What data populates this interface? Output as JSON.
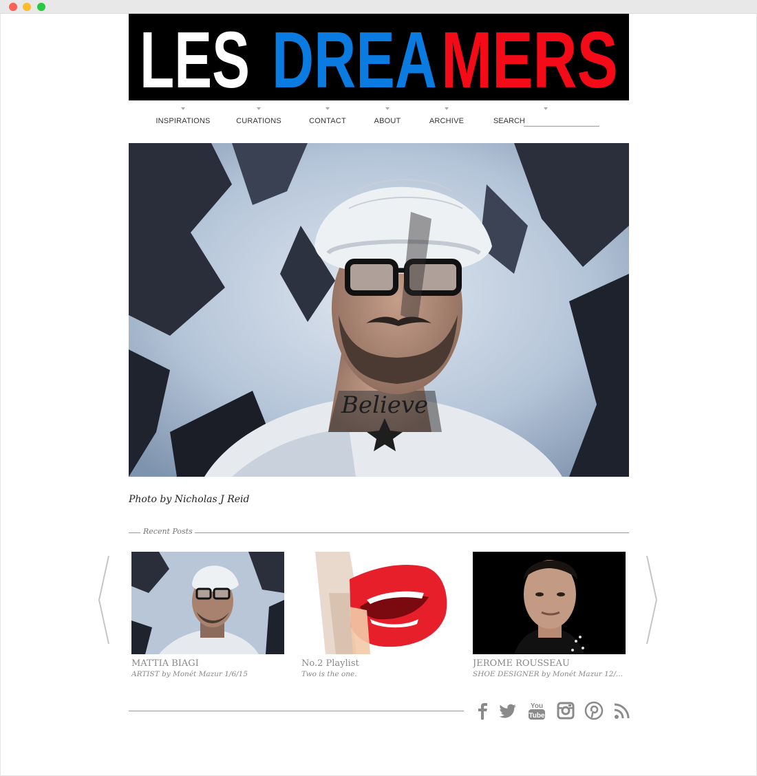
{
  "site": {
    "logo_words": [
      {
        "text": "LES",
        "color": "#ffffff"
      },
      {
        "text": "DREA",
        "color": "#0a7be0"
      },
      {
        "text": "MERS",
        "color": "#f50a17"
      }
    ]
  },
  "nav": {
    "items": [
      {
        "label": "INSPIRATIONS"
      },
      {
        "label": "CURATIONS"
      },
      {
        "label": "CONTACT"
      },
      {
        "label": "ABOUT"
      },
      {
        "label": "ARCHIVE"
      }
    ],
    "search_label": "SEARCH",
    "search_placeholder": ""
  },
  "hero": {
    "credit": "Photo by Nicholas J Reid",
    "tattoo_text": "Believe"
  },
  "recent": {
    "heading": "Recent Posts",
    "posts": [
      {
        "title": "MATTIA BIAGI",
        "meta": "ARTIST by Monét Mazur 1/6/15"
      },
      {
        "title": "No.2 Playlist",
        "meta": "Two is the one."
      },
      {
        "title": "JEROME ROUSSEAU",
        "meta": "SHOE DESIGNER by Monét Mazur 12/..."
      }
    ]
  },
  "footer": {
    "youtube_top": "You",
    "youtube_bottom": "Tube",
    "social_icons": [
      "facebook-icon",
      "twitter-icon",
      "youtube-icon",
      "instagram-icon",
      "pinterest-icon",
      "rss-icon"
    ],
    "icon_color": "#8a8a8a"
  }
}
